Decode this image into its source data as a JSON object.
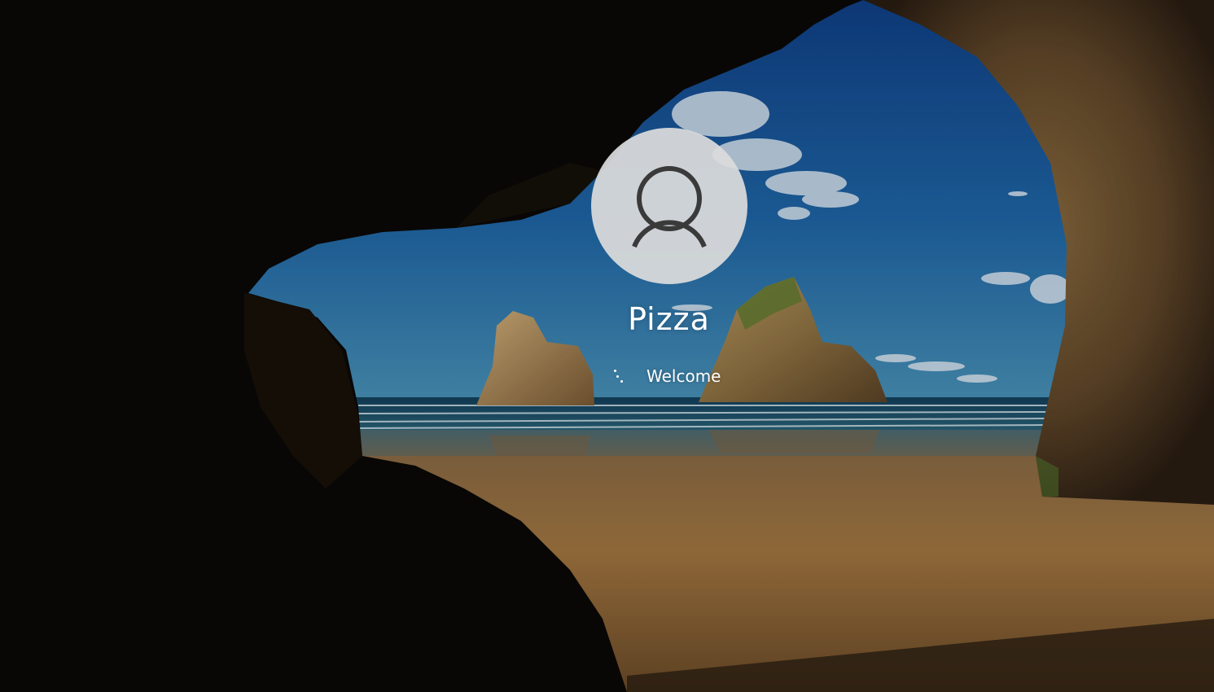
{
  "login": {
    "username": "Pizza",
    "status": "Welcome"
  },
  "icons": {
    "avatar": "user-silhouette-icon",
    "spinner": "loading-dots-icon"
  },
  "colors": {
    "sky": "#1f5f9e",
    "sea": "#2f6f8a",
    "sand": "#a67a45",
    "cave": "#0b0806",
    "avatar_bg": "#dcdcdc",
    "avatar_glyph": "#3a3a3a",
    "text": "#ffffff"
  }
}
